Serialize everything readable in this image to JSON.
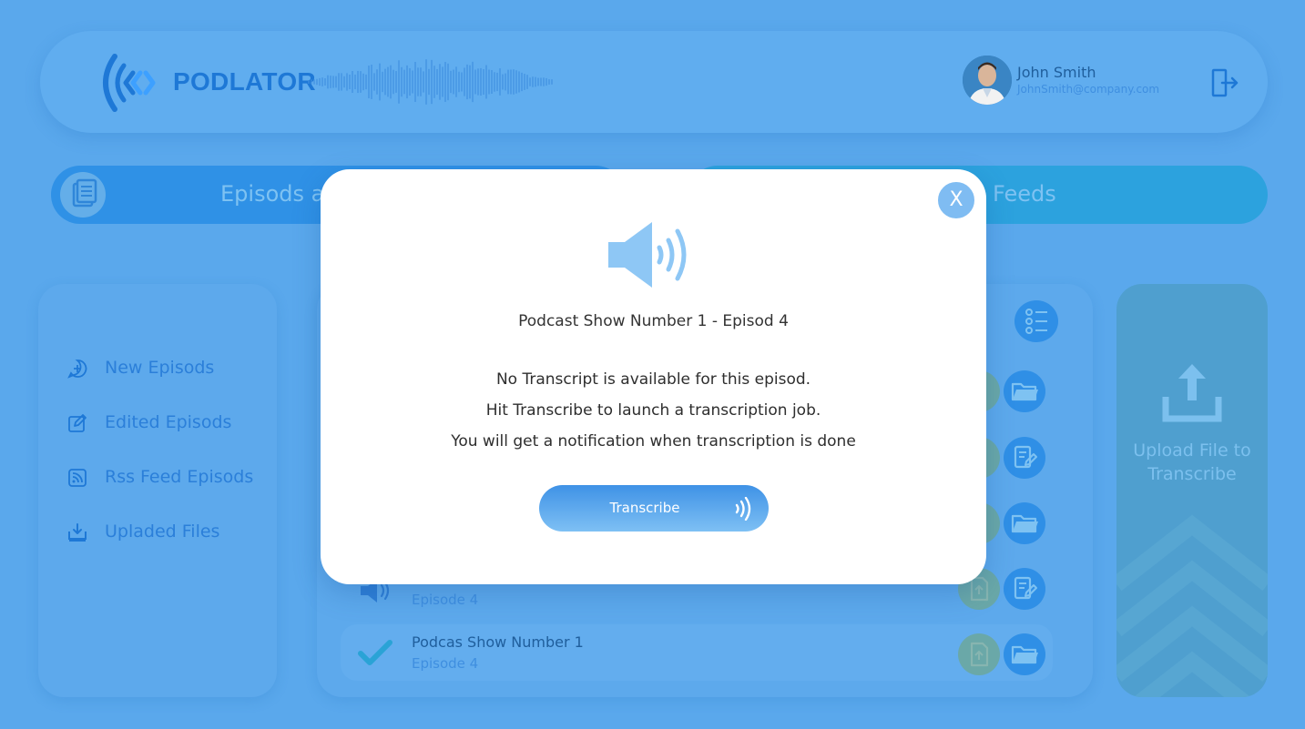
{
  "app": {
    "brand": "PODLATOR"
  },
  "user": {
    "name": "John Smith",
    "email": "JohnSmith@company.com"
  },
  "tabs": [
    {
      "label": "Episods a"
    },
    {
      "label": "Feeds"
    }
  ],
  "sidebar": {
    "items": [
      {
        "label": "New Episods",
        "icon": "chat-plus-icon"
      },
      {
        "label": "Edited Episods",
        "icon": "edit-icon"
      },
      {
        "label": "Rss Feed Episods",
        "icon": "rss-icon"
      },
      {
        "label": "Upladed Files",
        "icon": "download-icon"
      }
    ]
  },
  "episodes": {
    "rows": [
      {
        "title": "",
        "subtitle": "Episode 4"
      },
      {
        "title": "Podcas Show Number 1",
        "subtitle": "Episode 4"
      }
    ]
  },
  "upload": {
    "label": "Upload File to Transcribe"
  },
  "modal": {
    "close_label": "X",
    "title": "Podcast Show Number 1 - Episod 4",
    "line1": "No Transcript is available for this episod.",
    "line2": "Hit Transcribe to launch a transcription job.",
    "line3": "You will get a notification when transcription is done",
    "button_label": "Transcribe"
  },
  "colors": {
    "background": "#5aa8ec",
    "brand": "#1e78d6",
    "accent": "#2f8fe6",
    "modal_bg": "#ffffff"
  }
}
